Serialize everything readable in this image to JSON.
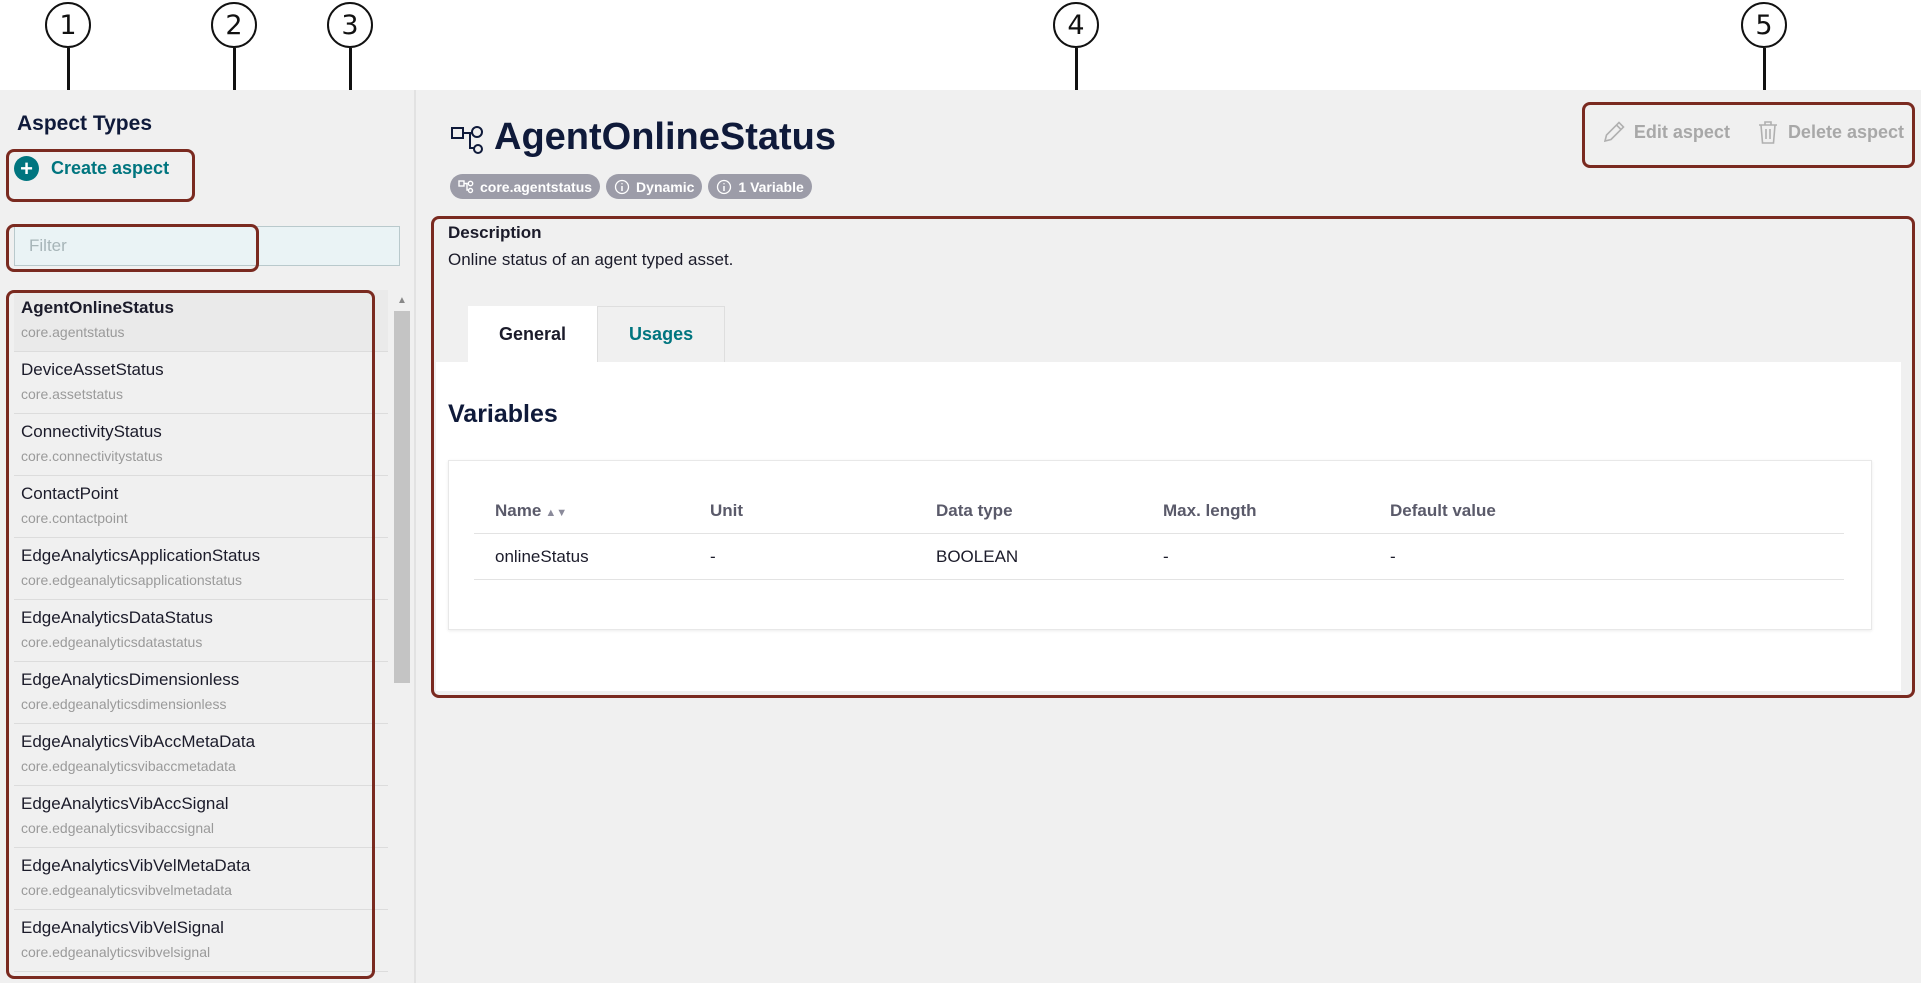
{
  "callouts": [
    "1",
    "2",
    "3",
    "4",
    "5"
  ],
  "sidebar": {
    "title": "Aspect Types",
    "create_label": "Create aspect",
    "filter_placeholder": "Filter",
    "items": [
      {
        "name": "AgentOnlineStatus",
        "id": "core.agentstatus",
        "selected": true
      },
      {
        "name": "DeviceAssetStatus",
        "id": "core.assetstatus"
      },
      {
        "name": "ConnectivityStatus",
        "id": "core.connectivitystatus"
      },
      {
        "name": "ContactPoint",
        "id": "core.contactpoint"
      },
      {
        "name": "EdgeAnalyticsApplicationStatus",
        "id": "core.edgeanalyticsapplicationstatus"
      },
      {
        "name": "EdgeAnalyticsDataStatus",
        "id": "core.edgeanalyticsdatastatus"
      },
      {
        "name": "EdgeAnalyticsDimensionless",
        "id": "core.edgeanalyticsdimensionless"
      },
      {
        "name": "EdgeAnalyticsVibAccMetaData",
        "id": "core.edgeanalyticsvibaccmetadata"
      },
      {
        "name": "EdgeAnalyticsVibAccSignal",
        "id": "core.edgeanalyticsvibaccsignal"
      },
      {
        "name": "EdgeAnalyticsVibVelMetaData",
        "id": "core.edgeanalyticsvibvelmetadata"
      },
      {
        "name": "EdgeAnalyticsVibVelSignal",
        "id": "core.edgeanalyticsvibvelsignal"
      }
    ]
  },
  "header": {
    "icon": "aspect-structure-icon",
    "title": "AgentOnlineStatus",
    "badges": [
      {
        "icon": "aspect-structure-icon",
        "label": "core.agentstatus"
      },
      {
        "icon": "info-circle-icon",
        "label": "Dynamic"
      },
      {
        "icon": "info-circle-icon",
        "label": "1 Variable"
      }
    ],
    "edit_label": "Edit aspect",
    "delete_label": "Delete aspect"
  },
  "description": {
    "label": "Description",
    "text": "Online status of an agent typed asset."
  },
  "tabs": [
    {
      "label": "General",
      "active": true
    },
    {
      "label": "Usages",
      "active": false
    }
  ],
  "variables": {
    "title": "Variables",
    "columns": [
      "Name",
      "Unit",
      "Data type",
      "Max. length",
      "Default value"
    ],
    "rows": [
      [
        "onlineStatus",
        "-",
        "BOOLEAN",
        "-",
        "-"
      ]
    ]
  },
  "colors": {
    "accent": "#00757f",
    "annotation_box": "#7a2a20",
    "badge": "#9c9ca8",
    "panel_bg": "#f0f0f0"
  }
}
